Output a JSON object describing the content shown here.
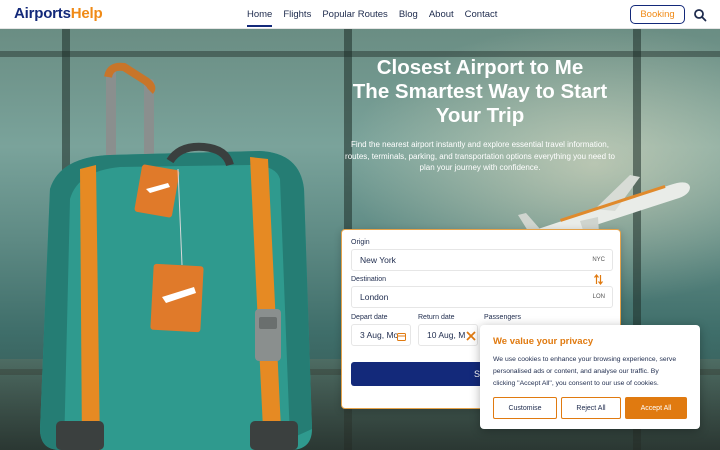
{
  "header": {
    "logo_part1": "Airports",
    "logo_part2": "Help",
    "nav": [
      {
        "label": "Home",
        "active": true
      },
      {
        "label": "Flights",
        "active": false
      },
      {
        "label": "Popular Routes",
        "active": false
      },
      {
        "label": "Blog",
        "active": false
      },
      {
        "label": "About",
        "active": false
      },
      {
        "label": "Contact",
        "active": false
      }
    ],
    "booking_label": "Booking",
    "search_icon": "search-icon"
  },
  "hero": {
    "title_line1": "Closest Airport to Me",
    "title_line2": "The Smartest Way to Start",
    "title_line3": "Your Trip",
    "subtitle_line1": "Find the nearest airport instantly and explore essential travel information,",
    "subtitle_line2": "routes, terminals, parking, and transportation options everything you need to",
    "subtitle_line3": "plan your journey with confidence."
  },
  "form": {
    "origin_label": "Origin",
    "origin_value": "New York",
    "origin_code": "NYC",
    "swap_icon": "swap-icon",
    "destination_label": "Destination",
    "destination_value": "London",
    "destination_code": "LON",
    "depart_label": "Depart date",
    "depart_value": "3 Aug, Mo",
    "return_label": "Return date",
    "return_value": "10 Aug, M",
    "passengers_label": "Passengers",
    "search_label": "Sea"
  },
  "cookie": {
    "title": "We value your privacy",
    "text_line1": "We use cookies to enhance your browsing experience, serve",
    "text_line2": "personalised ads or content, and analyse our traffic. By",
    "text_line3": "clicking \"Accept All\", you consent to our use of cookies.",
    "customise_label": "Customise",
    "reject_label": "Reject All",
    "accept_label": "Accept All"
  },
  "colors": {
    "brand_navy": "#13297a",
    "brand_orange": "#f08a16",
    "cookie_orange": "#e07a10"
  }
}
